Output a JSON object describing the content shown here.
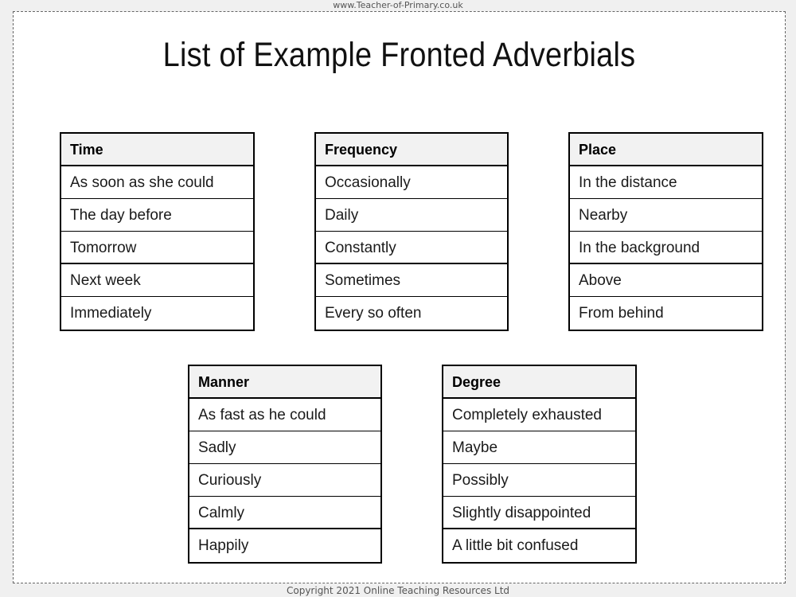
{
  "header": {
    "site_url": "www.Teacher-of-Primary.co.uk"
  },
  "page": {
    "title": "List of Example Fronted Adverbials"
  },
  "tables": [
    {
      "id": "time",
      "header": "Time",
      "rows": [
        "As soon as she could",
        "The day before",
        "Tomorrow",
        "Next week",
        "Immediately"
      ]
    },
    {
      "id": "frequency",
      "header": "Frequency",
      "rows": [
        "Occasionally",
        "Daily",
        "Constantly",
        "Sometimes",
        "Every so often"
      ]
    },
    {
      "id": "place",
      "header": "Place",
      "rows": [
        "In the distance",
        "Nearby",
        "In the background",
        "Above",
        "From behind"
      ]
    },
    {
      "id": "manner",
      "header": "Manner",
      "rows": [
        "As fast as he could",
        "Sadly",
        "Curiously",
        "Calmly",
        "Happily"
      ]
    },
    {
      "id": "degree",
      "header": "Degree",
      "rows": [
        "Completely exhausted",
        "Maybe",
        "Possibly",
        "Slightly disappointed",
        "A little bit confused"
      ]
    }
  ],
  "footer": {
    "copyright": "Copyright 2021 Online Teaching Resources Ltd"
  },
  "colors": {
    "page_background": "#ffffff",
    "outer_background": "#f0f0f0",
    "table_border": "#000000",
    "header_fill": "#f2f2f2",
    "text": "#1a1a1a"
  }
}
